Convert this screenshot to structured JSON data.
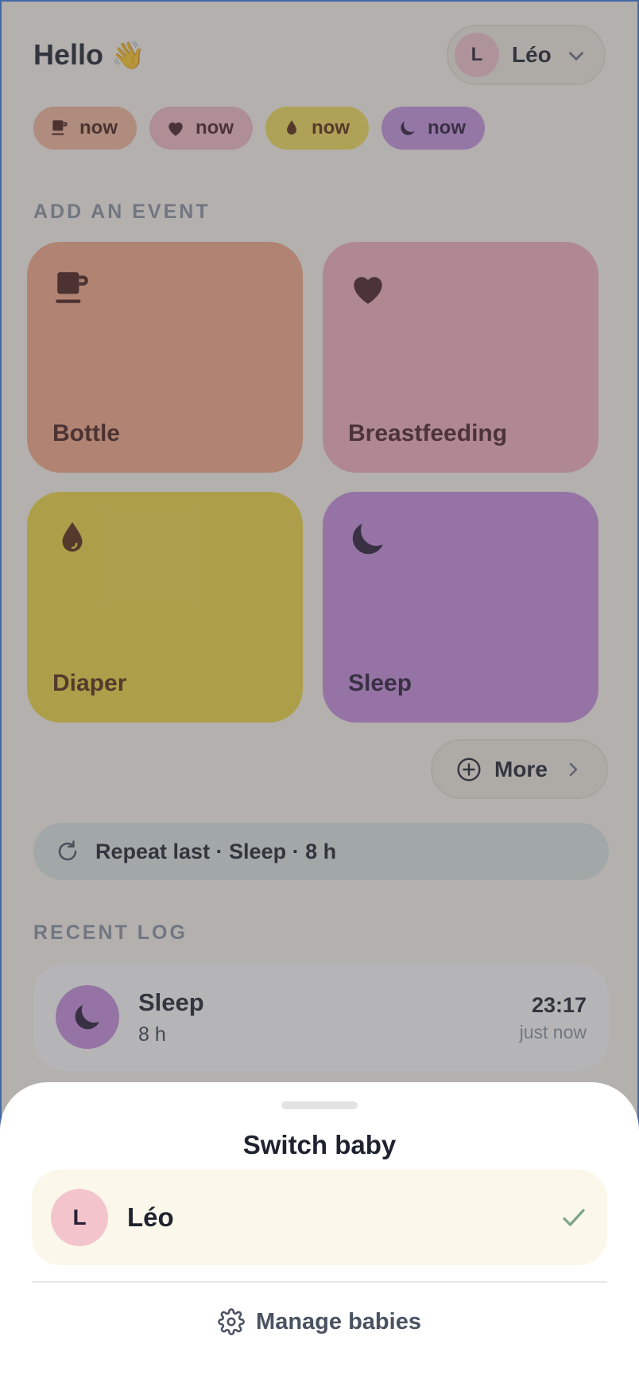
{
  "header": {
    "greeting": "Hello",
    "wave_emoji": "👋",
    "baby_initial": "L",
    "baby_name": "Léo"
  },
  "chips": [
    {
      "label": "now",
      "icon": "cup-icon"
    },
    {
      "label": "now",
      "icon": "heart-icon"
    },
    {
      "label": "now",
      "icon": "drop-icon"
    },
    {
      "label": "now",
      "icon": "moon-icon"
    }
  ],
  "add_event": {
    "title": "ADD AN EVENT",
    "tiles": [
      {
        "label": "Bottle",
        "icon": "cup-icon",
        "color": "#f7a98a"
      },
      {
        "label": "Breastfeeding",
        "icon": "heart-icon",
        "color": "#f6b2bd"
      },
      {
        "label": "Diaper",
        "icon": "drop-icon",
        "color": "#f2da44"
      },
      {
        "label": "Sleep",
        "icon": "moon-icon",
        "color": "#c890e0"
      }
    ],
    "more_label": "More"
  },
  "repeat": {
    "label": "Repeat last · Sleep · 8 h"
  },
  "recent_log": {
    "title": "RECENT LOG",
    "items": [
      {
        "title": "Sleep",
        "subtitle": "8 h",
        "time": "23:17",
        "ago": "just now",
        "icon": "moon-icon"
      }
    ]
  },
  "sheet": {
    "title": "Switch baby",
    "baby_initial": "L",
    "baby_name": "Léo",
    "manage_label": "Manage babies"
  },
  "colors": {
    "overlay": "rgba(78,78,84,0.42)",
    "check": "#7da58a",
    "accent_border": "#3d7be0"
  }
}
